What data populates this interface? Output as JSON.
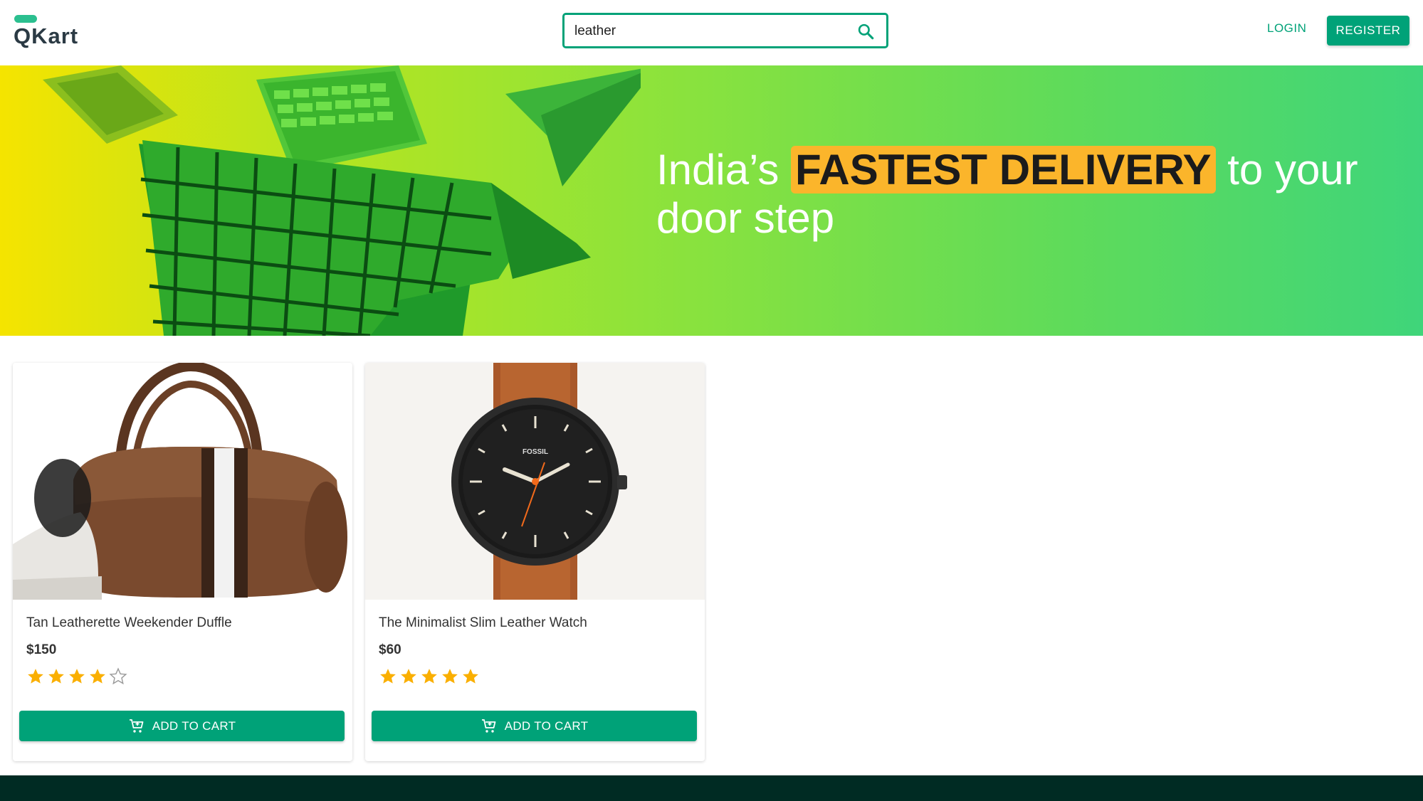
{
  "header": {
    "logo_text": "QKart",
    "search": {
      "value": "leather",
      "placeholder": "Search for items/categories"
    },
    "login_label": "LOGIN",
    "register_label": "REGISTER"
  },
  "hero": {
    "text_before": "India’s ",
    "highlight": "FASTEST DELIVERY",
    "text_after": " to your door step"
  },
  "products": [
    {
      "name": "Tan Leatherette Weekender Duffle",
      "price": "$150",
      "rating": 4,
      "button_label": "ADD TO CART"
    },
    {
      "name": "The Minimalist Slim Leather Watch",
      "price": "$60",
      "rating": 5,
      "button_label": "ADD TO CART"
    }
  ],
  "colors": {
    "accent": "#00a278",
    "highlight": "#fbb52b",
    "star": "#faaf00",
    "footer": "#002b23"
  },
  "icons": {
    "search": "search-icon",
    "cart": "add-shopping-cart-icon",
    "star": "star-icon"
  }
}
